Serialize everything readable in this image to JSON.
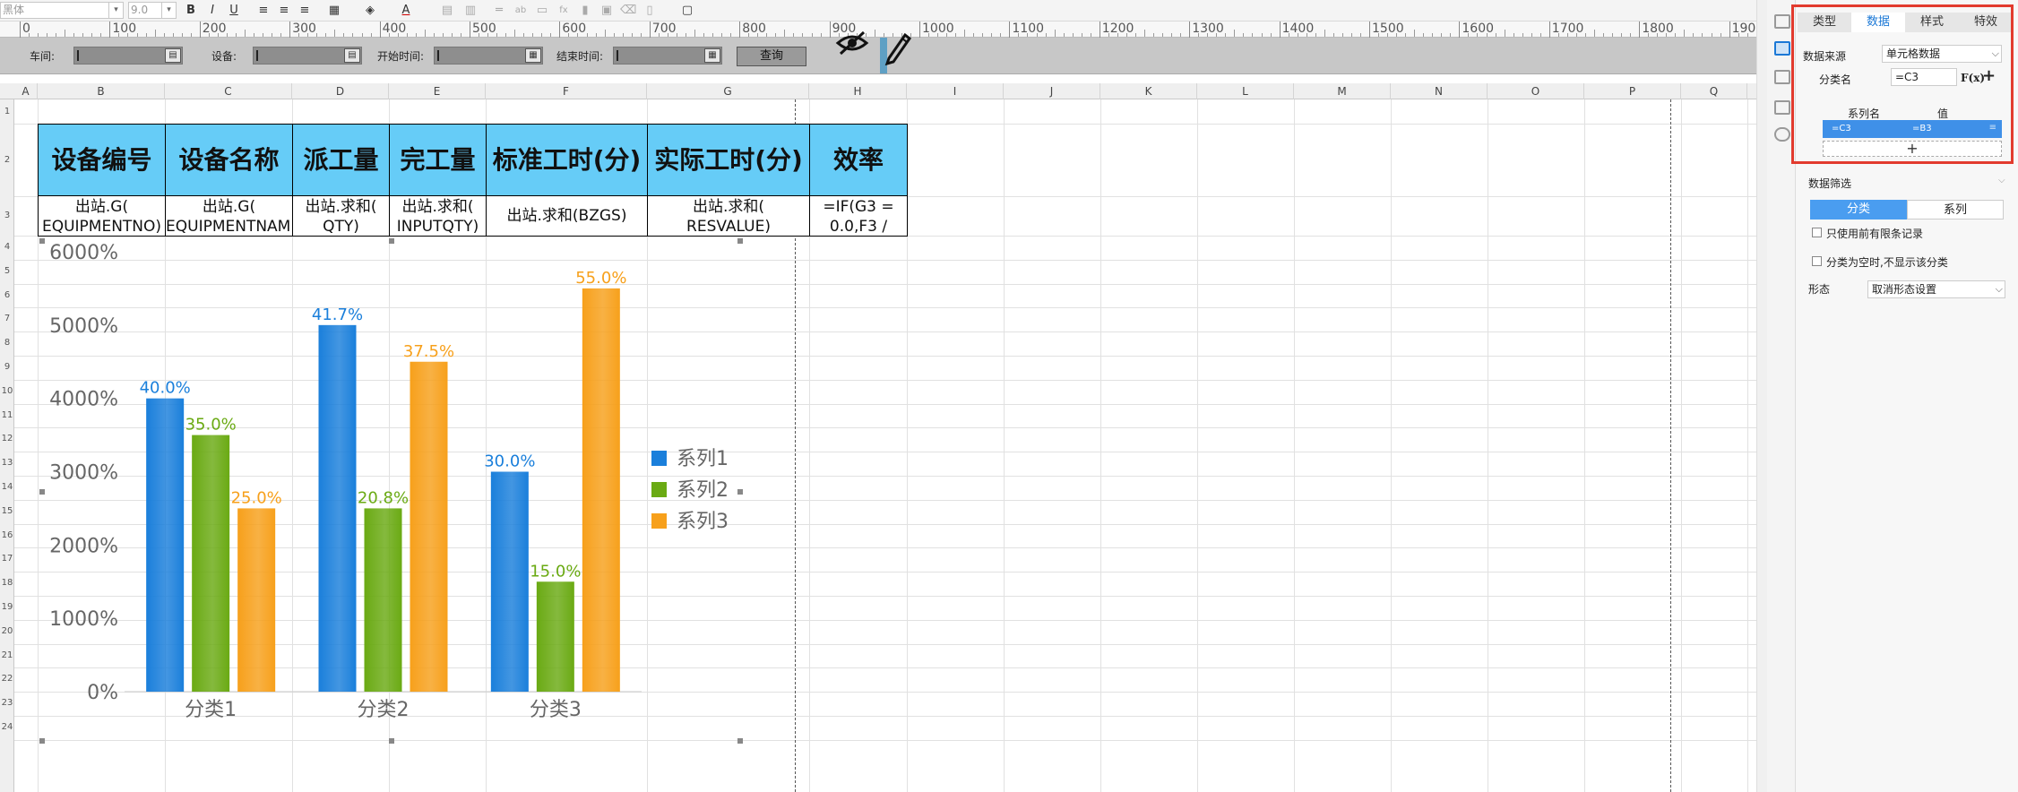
{
  "toolbar": {
    "font_name": "黑体",
    "font_size": "9.0",
    "bold": "B",
    "italic": "I",
    "underline": "U",
    "text_color_glyph": "A"
  },
  "ruler": {
    "ticks": [
      "0",
      "100",
      "200",
      "300",
      "400",
      "500",
      "600",
      "700",
      "800",
      "900",
      "1000",
      "1100",
      "1200",
      "1300",
      "1400",
      "1500",
      "1600",
      "1700",
      "1800",
      "1900"
    ]
  },
  "params": {
    "workshop_label": "车间:",
    "device_label": "设备:",
    "start_label": "开始时间:",
    "end_label": "结束时间:",
    "query_button": "查询"
  },
  "columns": [
    "A",
    "B",
    "C",
    "D",
    "E",
    "F",
    "G",
    "H",
    "I",
    "J",
    "K",
    "L",
    "M",
    "N",
    "O",
    "P",
    "Q"
  ],
  "rows": [
    "1",
    "2",
    "3",
    "4",
    "5",
    "6",
    "7",
    "8",
    "9",
    "10",
    "11",
    "12",
    "13",
    "14",
    "15",
    "16",
    "17",
    "18",
    "19",
    "20",
    "21",
    "22",
    "23",
    "24"
  ],
  "table": {
    "headers": [
      "设备编号",
      "设备名称",
      "派工量",
      "完工量",
      "标准工时(分)",
      "实际工时(分)",
      "效率"
    ],
    "formulas": [
      [
        "出站.G(",
        "EQUIPMENTNO)"
      ],
      [
        "出站.G(",
        "EQUIPMENTNAME"
      ],
      [
        "出站.求和(",
        "QTY)"
      ],
      [
        "出站.求和(",
        "INPUTQTY)"
      ],
      [
        "出站.求和(BZGS)",
        ""
      ],
      [
        "出站.求和(",
        "RESVALUE)"
      ],
      [
        "=IF(G3 =",
        "0.0,F3 /"
      ]
    ]
  },
  "chart_data": {
    "type": "bar",
    "categories": [
      "分类1",
      "分类2",
      "分类3"
    ],
    "series": [
      {
        "name": "系列1",
        "values": [
          40.0,
          41.7,
          30.0
        ],
        "color": "#1a7fdb"
      },
      {
        "name": "系列2",
        "values": [
          35.0,
          20.8,
          15.0
        ],
        "color": "#6aaa13"
      },
      {
        "name": "系列3",
        "values": [
          25.0,
          37.5,
          55.0
        ],
        "color": "#f7a01b"
      }
    ],
    "bar_heights_pct": [
      [
        4000,
        5000,
        3000
      ],
      [
        3500,
        2500,
        1500
      ],
      [
        2500,
        4500,
        5500
      ]
    ],
    "data_labels": [
      [
        "40.0%",
        "41.7%",
        "30.0%"
      ],
      [
        "35.0%",
        "20.8%",
        "15.0%"
      ],
      [
        "25.0%",
        "37.5%",
        "55.0%"
      ]
    ],
    "y_ticks": [
      "0%",
      "1000%",
      "2000%",
      "3000%",
      "4000%",
      "5000%",
      "6000%"
    ],
    "ylim": [
      0,
      6000
    ],
    "legend_placement": "right",
    "grid": false
  },
  "panel": {
    "tabs": [
      "类型",
      "数据",
      "样式",
      "特效"
    ],
    "active_tab": "数据",
    "data_source_label": "数据来源",
    "data_source_value": "单元格数据",
    "category_name_label": "分类名",
    "category_name_value": "=C3",
    "fx_label": "F(x)",
    "add_glyph": "+",
    "series_name_header": "系列名",
    "value_header": "值",
    "series_row_name": "=C3",
    "series_row_value": "=B3",
    "add_row_glyph": "+",
    "filter_section": "数据筛选",
    "seg_category": "分类",
    "seg_series": "系列",
    "check_limit_records": "只使用前有限条记录",
    "check_empty_category": "分类为空时,不显示该分类",
    "form_label": "形态",
    "form_value": "取消形态设置"
  }
}
